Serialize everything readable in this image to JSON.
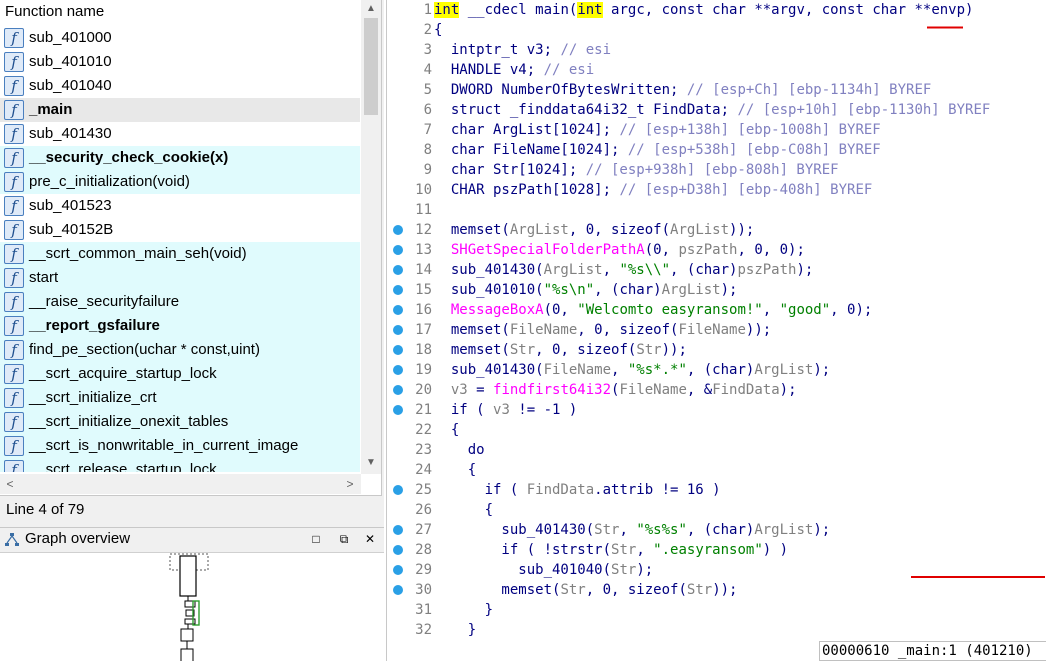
{
  "functions_window": {
    "header": "Function name",
    "items": [
      {
        "name": "sub_401000",
        "style": "plain"
      },
      {
        "name": "sub_401010",
        "style": "plain"
      },
      {
        "name": "sub_401040",
        "style": "plain"
      },
      {
        "name": "_main",
        "style": "selected-bold"
      },
      {
        "name": "sub_401430",
        "style": "plain"
      },
      {
        "name": "__security_check_cookie(x)",
        "style": "cyan-bold"
      },
      {
        "name": "pre_c_initialization(void)",
        "style": "cyan"
      },
      {
        "name": "sub_401523",
        "style": "plain"
      },
      {
        "name": "sub_40152B",
        "style": "plain"
      },
      {
        "name": "__scrt_common_main_seh(void)",
        "style": "cyan"
      },
      {
        "name": "start",
        "style": "cyan"
      },
      {
        "name": "__raise_securityfailure",
        "style": "cyan"
      },
      {
        "name": "__report_gsfailure",
        "style": "cyan-bold"
      },
      {
        "name": "find_pe_section(uchar * const,uint)",
        "style": "cyan"
      },
      {
        "name": "__scrt_acquire_startup_lock",
        "style": "cyan"
      },
      {
        "name": "__scrt_initialize_crt",
        "style": "cyan"
      },
      {
        "name": "__scrt_initialize_onexit_tables",
        "style": "cyan"
      },
      {
        "name": "__scrt_is_nonwritable_in_current_image",
        "style": "cyan"
      },
      {
        "name": "__scrt_release_startup_lock",
        "style": "cyan"
      }
    ],
    "status": "Line 4 of 79"
  },
  "graph_overview": {
    "title": "Graph overview",
    "buttons": {
      "maximize": "□",
      "float": "⧉",
      "close": "✕"
    }
  },
  "pseudocode": {
    "lines": [
      {
        "n": "1",
        "bp": false,
        "html": "<span class=\"hl\">int</span> __cdecl main(<span class=\"hl\">int</span> argc, const char **argv, const char **envp)"
      },
      {
        "n": "2",
        "bp": false,
        "html": "{"
      },
      {
        "n": "3",
        "bp": false,
        "html": "  intptr_t v3; <span class=\"cm\">// esi</span>"
      },
      {
        "n": "4",
        "bp": false,
        "html": "  HANDLE v4; <span class=\"cm\">// esi</span>"
      },
      {
        "n": "5",
        "bp": false,
        "html": "  DWORD NumberOfBytesWritten; <span class=\"cm\">// [esp+Ch] [ebp-1134h] BYREF</span>"
      },
      {
        "n": "6",
        "bp": false,
        "html": "  struct _finddata64i32_t FindData; <span class=\"cm\">// [esp+10h] [ebp-1130h] BYREF</span>"
      },
      {
        "n": "7",
        "bp": false,
        "html": "  char ArgList[1024]; <span class=\"cm\">// [esp+138h] [ebp-1008h] BYREF</span>"
      },
      {
        "n": "8",
        "bp": false,
        "html": "  char FileName[1024]; <span class=\"cm\">// [esp+538h] [ebp-C08h] BYREF</span>"
      },
      {
        "n": "9",
        "bp": false,
        "html": "  char Str[1024]; <span class=\"cm\">// [esp+938h] [ebp-808h] BYREF</span>"
      },
      {
        "n": "10",
        "bp": false,
        "html": "  CHAR pszPath[1028]; <span class=\"cm\">// [esp+D38h] [ebp-408h] BYREF</span>"
      },
      {
        "n": "11",
        "bp": false,
        "html": ""
      },
      {
        "n": "12",
        "bp": true,
        "html": "  memset(<span class=\"var\">ArgList</span>, 0, sizeof(<span class=\"var\">ArgList</span>));"
      },
      {
        "n": "13",
        "bp": true,
        "html": "  <span class=\"glob\">SHGetSpecialFolderPathA</span>(0, <span class=\"var\">pszPath</span>, 0, 0);"
      },
      {
        "n": "14",
        "bp": true,
        "html": "  sub_401430(<span class=\"var\">ArgList</span>, <span class=\"str\">\"%s\\\\\"</span>, (char)<span class=\"var\">pszPath</span>);"
      },
      {
        "n": "15",
        "bp": true,
        "html": "  sub_401010(<span class=\"str\">\"%s\\n\"</span>, (char)<span class=\"var\">ArgList</span>);"
      },
      {
        "n": "16",
        "bp": true,
        "html": "  <span class=\"glob\">MessageBoxA</span>(0, <span class=\"str\">\"Welcomto easyransom!\"</span>, <span class=\"str\">\"good\"</span>, 0);"
      },
      {
        "n": "17",
        "bp": true,
        "html": "  memset(<span class=\"var\">FileName</span>, 0, sizeof(<span class=\"var\">FileName</span>));"
      },
      {
        "n": "18",
        "bp": true,
        "html": "  memset(<span class=\"var\">Str</span>, 0, sizeof(<span class=\"var\">Str</span>));"
      },
      {
        "n": "19",
        "bp": true,
        "html": "  sub_401430(<span class=\"var\">FileName</span>, <span class=\"str\">\"%s*.*\"</span>, (char)<span class=\"var\">ArgList</span>);"
      },
      {
        "n": "20",
        "bp": true,
        "html": "  <span class=\"var\">v3</span> = <span class=\"glob\">findfirst64i32</span>(<span class=\"var\">FileName</span>, &amp;<span class=\"var\">FindData</span>);"
      },
      {
        "n": "21",
        "bp": true,
        "html": "  if ( <span class=\"var\">v3</span> != -1 )"
      },
      {
        "n": "22",
        "bp": false,
        "html": "  {"
      },
      {
        "n": "23",
        "bp": false,
        "html": "    do"
      },
      {
        "n": "24",
        "bp": false,
        "html": "    {"
      },
      {
        "n": "25",
        "bp": true,
        "html": "      if ( <span class=\"var\">FindData</span>.attrib != 16 )"
      },
      {
        "n": "26",
        "bp": false,
        "html": "      {"
      },
      {
        "n": "27",
        "bp": true,
        "html": "        sub_401430(<span class=\"var\">Str</span>, <span class=\"str\">\"%s%s\"</span>, (char)<span class=\"var\">ArgList</span>);"
      },
      {
        "n": "28",
        "bp": true,
        "html": "        if ( !strstr(<span class=\"var\">Str</span>, <span class=\"str\">\".easyransom\"</span>) )"
      },
      {
        "n": "29",
        "bp": true,
        "html": "          sub_401040(<span class=\"var\">Str</span>);"
      },
      {
        "n": "30",
        "bp": true,
        "html": "        memset(<span class=\"var\">Str</span>, 0, sizeof(<span class=\"var\">Str</span>));"
      },
      {
        "n": "31",
        "bp": false,
        "html": "      }"
      },
      {
        "n": "32",
        "bp": false,
        "html": "    }"
      }
    ],
    "status": "00000610 _main:1 (401210)"
  },
  "colors": {
    "accent_underline": "#e00000",
    "highlight": "#ffff00",
    "breakpoint": "#2aa0e6"
  }
}
